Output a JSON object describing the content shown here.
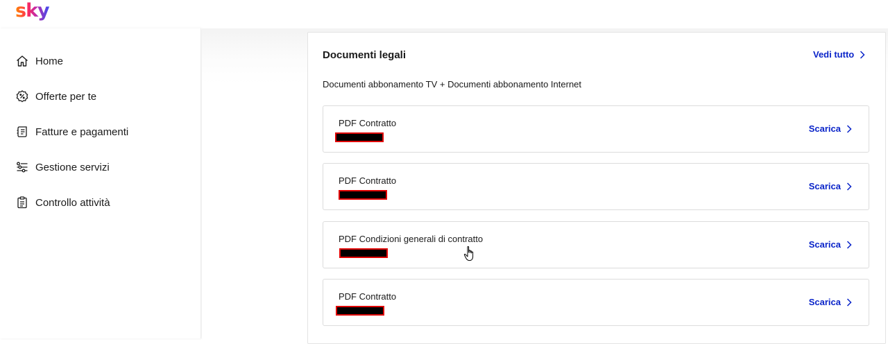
{
  "header": {
    "logo_text": "sky"
  },
  "sidebar": {
    "items": [
      {
        "label": "Home",
        "icon": "home-icon"
      },
      {
        "label": "Offerte per te",
        "icon": "offer-badge-icon"
      },
      {
        "label": "Fatture e pagamenti",
        "icon": "invoice-icon"
      },
      {
        "label": "Gestione servizi",
        "icon": "sliders-icon"
      },
      {
        "label": "Controllo attività",
        "icon": "clipboard-icon"
      }
    ]
  },
  "legal": {
    "title": "Documenti legali",
    "see_all": "Vedi tutto",
    "subtitle": "Documenti abbonamento TV + Documenti abbonamento Internet",
    "documents": [
      {
        "name": "PDF Contratto",
        "action": "Scarica"
      },
      {
        "name": "PDF Contratto",
        "action": "Scarica"
      },
      {
        "name": "PDF Condizioni generali di contratto",
        "action": "Scarica"
      },
      {
        "name": "PDF Contratto",
        "action": "Scarica"
      }
    ]
  },
  "colors": {
    "accent": "#0a24c9",
    "redaction_border": "#e00000"
  }
}
